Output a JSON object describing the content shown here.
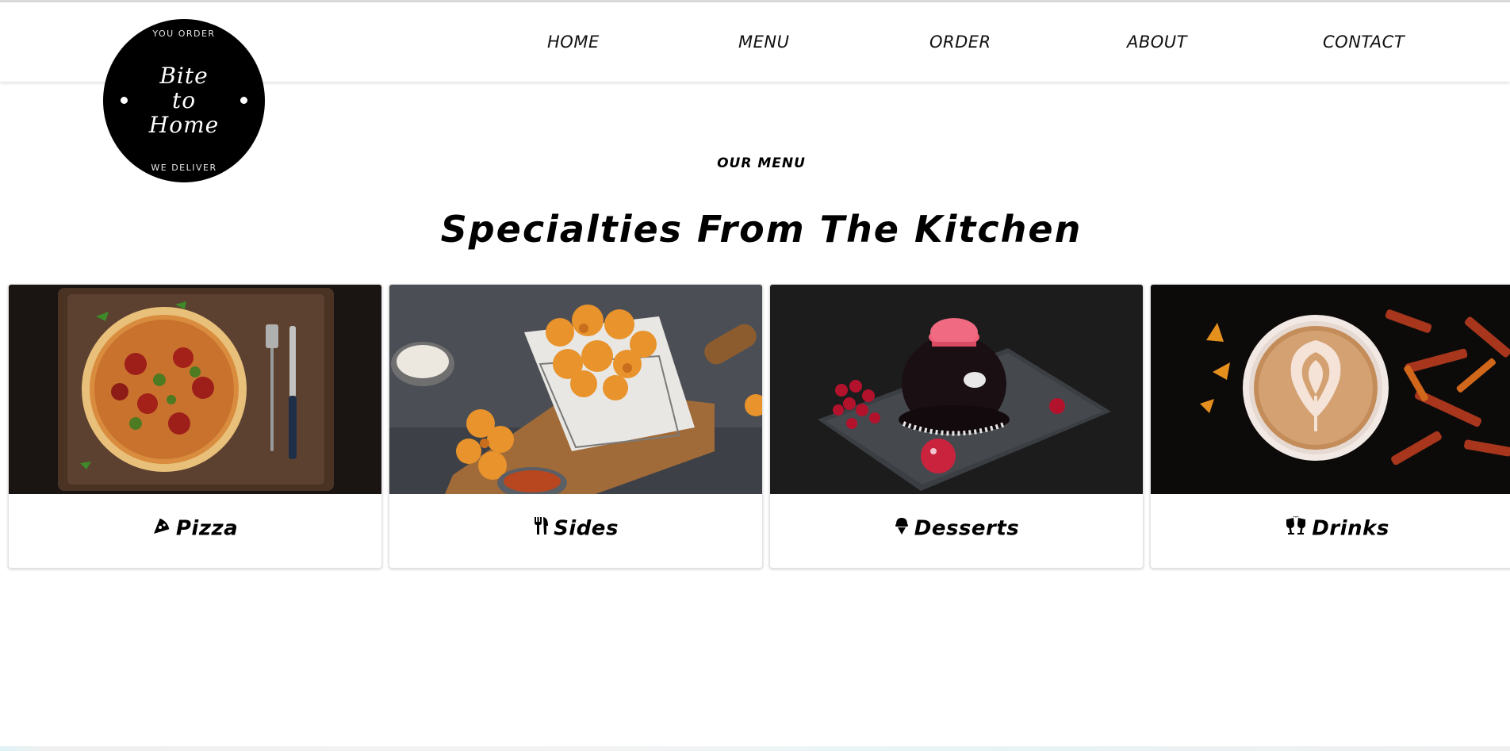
{
  "nav": {
    "items": [
      {
        "label": "HOME"
      },
      {
        "label": "MENU"
      },
      {
        "label": "ORDER"
      },
      {
        "label": "ABOUT"
      },
      {
        "label": "CONTACT"
      }
    ]
  },
  "logo": {
    "top_text": "YOU ORDER",
    "lines": [
      "Bite",
      "to",
      "Home"
    ],
    "bottom_text": "WE DELIVER"
  },
  "section": {
    "eyebrow": "OUR MENU",
    "heading": "Specialties From The Kitchen"
  },
  "cards": [
    {
      "label": "Pizza",
      "icon": "pizza-slice-icon"
    },
    {
      "label": "Sides",
      "icon": "utensils-icon"
    },
    {
      "label": "Desserts",
      "icon": "ice-cream-icon"
    },
    {
      "label": "Drinks",
      "icon": "glasses-cheers-icon"
    }
  ]
}
